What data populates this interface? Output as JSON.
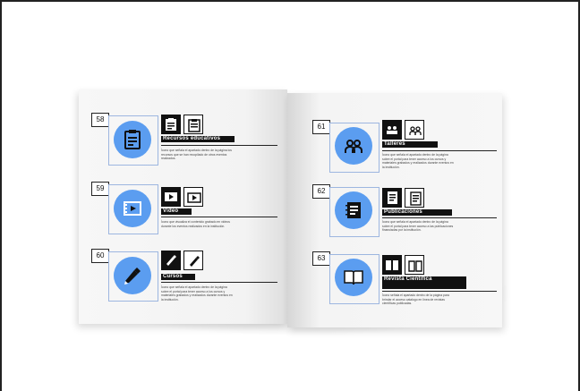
{
  "entries": [
    {
      "number": "58",
      "title": "Recursos educativos",
      "description": "Ícono que señala el apartado dentro de la página los recursos que se han recopilado de otros eventos realizados.",
      "icon": "clipboard-icon"
    },
    {
      "number": "59",
      "title": "Video",
      "description": "Ícono que visualiza el contenido grabado en videos durante los eventos realizados en la institución.",
      "icon": "video-icon"
    },
    {
      "number": "60",
      "title": "Cursos",
      "description": "Ícono que señala el apartado dentro de la página sobre el portal para tener acceso a los cursos y materiales grabados y realizados durante eventos en la institución.",
      "icon": "pen-icon"
    },
    {
      "number": "61",
      "title": "Talleres",
      "description": "Ícono que señala el apartado dentro de la página sobre el portal para tener acceso a los cursos y materiales grabados y realizados durante eventos en la institución.",
      "icon": "people-icon"
    },
    {
      "number": "62",
      "title": "Publicaciones",
      "description": "Ícono que señala el apartado dentro de la página sobre el portal para tener acceso a las publicaciones financiadas por la institución.",
      "icon": "notebook-icon"
    },
    {
      "number": "63",
      "title": "Revista Científica",
      "description": "Ícono señala el apartado dentro de la página para brindar el acceso catalogo en línea de revistas científicas publicadas.",
      "icon": "book-icon"
    }
  ],
  "colors": {
    "accent": "#5b9df0",
    "ink": "#111111",
    "page": "#f6f6f6"
  }
}
